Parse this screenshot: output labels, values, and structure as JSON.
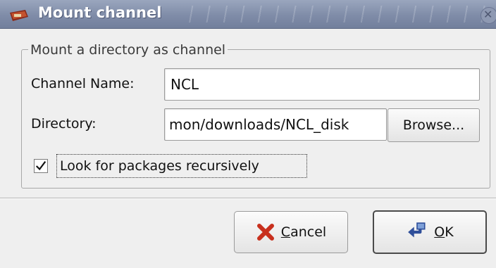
{
  "dialog": {
    "title": "Mount channel",
    "group_title": "Mount a directory as channel",
    "channel_name": {
      "label": "Channel Name:",
      "value": "NCL"
    },
    "directory": {
      "label": "Directory:",
      "value": "mon/downloads/NCL_disk"
    },
    "browse_label": "Browse...",
    "recursive": {
      "label": "Look for packages recursively",
      "checked": true
    },
    "cancel": {
      "mnemonic": "C",
      "rest": "ancel"
    },
    "ok": {
      "mnemonic": "O",
      "rest": "K"
    }
  },
  "icons": [
    "mount-channel-icon",
    "close-icon",
    "checkmark-icon",
    "cancel-x-icon",
    "ok-icon"
  ],
  "colors": {
    "titlebar": "#7f8ca8",
    "cancel_x": "#c8301e",
    "ok_icon": "#2f4f9a"
  }
}
